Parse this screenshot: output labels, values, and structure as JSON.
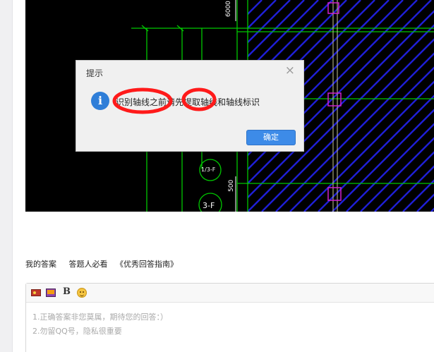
{
  "cad_canvas": {
    "dimension_labels": [
      "6000",
      "500"
    ],
    "axis_labels": [
      "1/3-F",
      "3-F"
    ]
  },
  "dialog": {
    "title": "提示",
    "close_glyph": "×",
    "info_glyph": "i",
    "message": "识别轴线之前请先提取轴线和轴线标识",
    "ok_label": "确定"
  },
  "answer_tabs": {
    "my_answer": "我的答案",
    "must_read": "答题人必看",
    "guide": "《优秀回答指南》"
  },
  "editor": {
    "toolbar": {
      "image_icon": "image-icon",
      "video_icon": "video-icon",
      "bold_label": "B",
      "emoji_icon": "emoji-icon"
    },
    "placeholder_line1": "1.正确答案非您莫属，期待您的回答：）",
    "placeholder_line2": "2.勿留QQ号，隐私很重要"
  },
  "colors": {
    "cad_background": "#000000",
    "cad_green": "#00c800",
    "cad_hatch": "#1f1fd6",
    "cad_magenta": "#d020d0",
    "annotation_red": "#ff1a1a",
    "dialog_button": "#3d8be8"
  }
}
